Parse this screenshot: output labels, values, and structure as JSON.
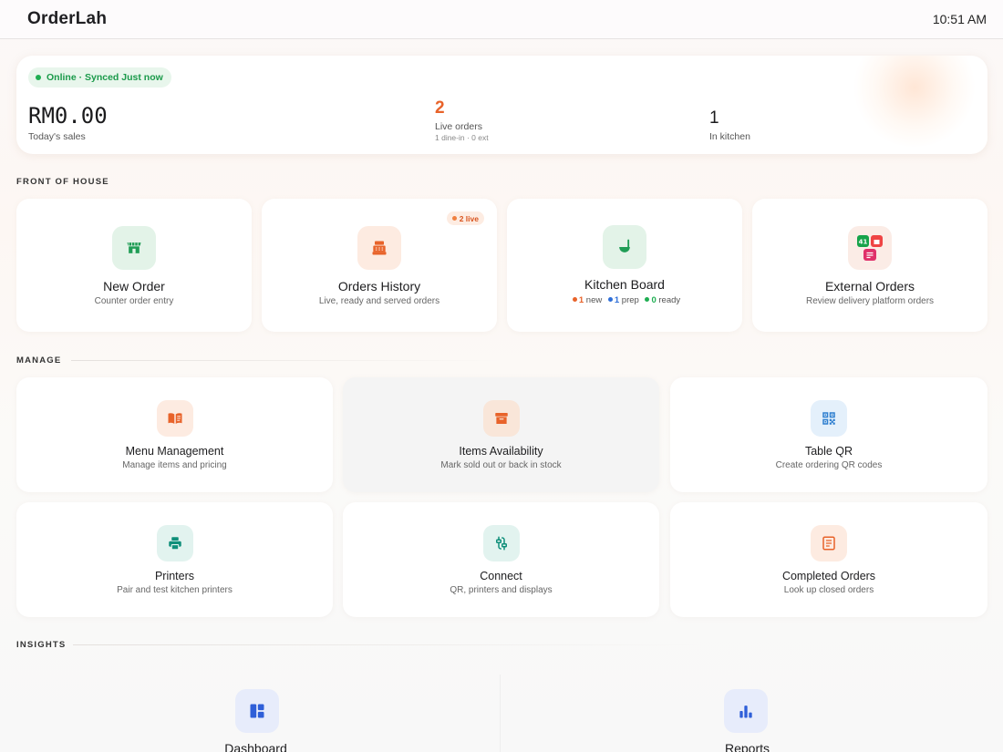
{
  "header": {
    "app_title": "OrderLah",
    "clock": "10:51 AM"
  },
  "summary": {
    "status": "Online · Synced Just now",
    "sales_value": "RM0.00",
    "sales_label": "Today's sales",
    "live_orders_value": "2",
    "live_orders_label": "Live orders",
    "live_orders_sub": "1 dine-in · 0 ext",
    "kitchen_value": "1",
    "kitchen_label": "In kitchen"
  },
  "sections": {
    "front_of_house": "FRONT OF HOUSE",
    "manage": "MANAGE",
    "insights": "INSIGHTS"
  },
  "front_of_house": {
    "new_order": {
      "title": "New Order",
      "subtitle": "Counter order entry",
      "icon": "storefront-icon"
    },
    "orders_history": {
      "title": "Orders History",
      "subtitle": "Live, ready and served orders",
      "badge": "2 live",
      "icon": "cash-register-icon"
    },
    "kitchen_board": {
      "title": "Kitchen Board",
      "icon": "ladle-icon",
      "new_count": "1",
      "new_label": "new",
      "prep_count": "1",
      "prep_label": "prep",
      "ready_count": "0",
      "ready_label": "ready"
    },
    "external_orders": {
      "title": "External Orders",
      "subtitle": "Review delivery platform orders",
      "icon": "delivery-apps-icon"
    }
  },
  "manage": {
    "menu_management": {
      "title": "Menu Management",
      "subtitle": "Manage items and pricing",
      "icon": "menu-book-icon"
    },
    "items_availability": {
      "title": "Items Availability",
      "subtitle": "Mark sold out or back in stock",
      "icon": "archive-box-icon"
    },
    "table_qr": {
      "title": "Table QR",
      "subtitle": "Create ordering QR codes",
      "icon": "qr-code-icon"
    },
    "printers": {
      "title": "Printers",
      "subtitle": "Pair and test kitchen printers",
      "icon": "printer-icon"
    },
    "connect": {
      "title": "Connect",
      "subtitle": "QR, printers and displays",
      "icon": "connect-icon"
    },
    "completed_orders": {
      "title": "Completed Orders",
      "subtitle": "Look up closed orders",
      "icon": "receipt-icon"
    }
  },
  "insights": {
    "dashboard": {
      "title": "Dashboard",
      "icon": "dashboard-icon"
    },
    "reports": {
      "title": "Reports",
      "icon": "bar-chart-icon"
    }
  },
  "colors": {
    "accent_orange": "#e8632a",
    "online_green": "#1fae52",
    "prep_blue": "#2f6fd8"
  }
}
